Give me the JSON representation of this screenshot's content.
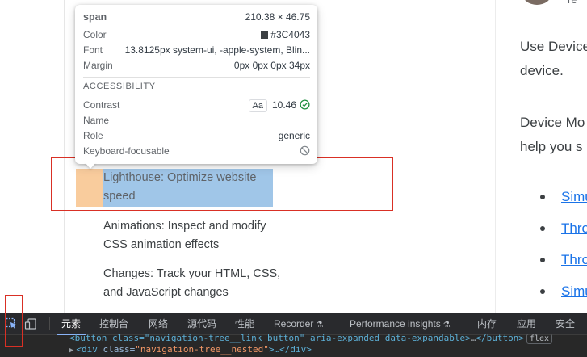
{
  "tooltip": {
    "tag": "span",
    "dimensions": "210.38 × 46.75",
    "rows": [
      {
        "key": "Color",
        "value": "#3C4043"
      },
      {
        "key": "Font",
        "value": "13.8125px system-ui, -apple-system, Blin..."
      },
      {
        "key": "Margin",
        "value": "0px 0px 0px 34px"
      }
    ],
    "accessibility_title": "ACCESSIBILITY",
    "accessibility": {
      "contrast_label": "Contrast",
      "contrast_badge": "Aa",
      "contrast_value": "10.46",
      "name_label": "Name",
      "role_label": "Role",
      "role_value": "generic",
      "focusable_label": "Keyboard-focusable"
    },
    "swatch_color": "#3C4043"
  },
  "nav": {
    "lighthouse": "Lighthouse: Optimize website speed",
    "animations": "Animations: Inspect and modify CSS animation effects",
    "changes": "Changes: Track your HTML, CSS, and JavaScript changes"
  },
  "article": {
    "p1_line1": "Use Device",
    "p1_line2": "device.",
    "p2_line1": "Device Mo",
    "p2_line2": "help you s",
    "bullets": [
      "Simu",
      "Thro",
      "Thro",
      "Simu"
    ],
    "avatar_text": "re"
  },
  "devtools": {
    "tabs": [
      "元素",
      "控制台",
      "网络",
      "源代码",
      "性能",
      "Recorder",
      "Performance insights",
      "内存",
      "应用",
      "安全"
    ],
    "active_tab": "元素",
    "code_line1": {
      "open": "<button class=\"navigation-tree__link button\" aria-expanded data-expandable>",
      "ellipsis": "…",
      "close": "</button>",
      "badge": "flex"
    },
    "code_line2": {
      "tag_open": "<div ",
      "attr": "class=",
      "value": "\"navigation-tree__nested\"",
      "after": ">…</div>"
    }
  },
  "colors": {
    "highlight_padding": "#f6b26b",
    "highlight_content": "#6fa8dc",
    "annotation_red": "#d93025",
    "link": "#1a73e8",
    "devtools_bg": "#292a2d",
    "active_tab_underline": "#8ab4f8"
  }
}
